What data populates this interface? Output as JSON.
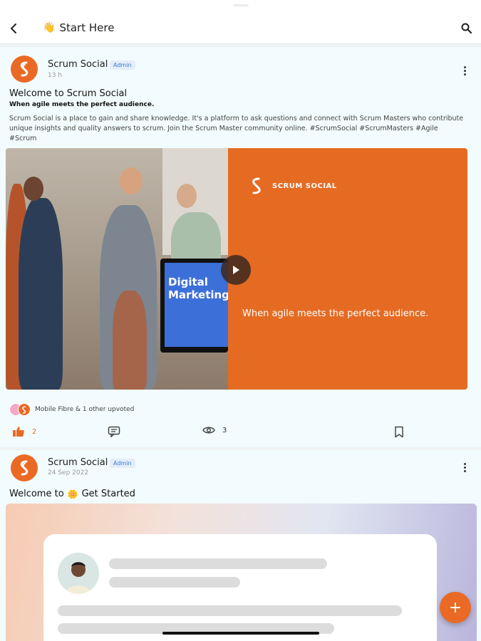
{
  "header": {
    "title": "Start Here",
    "title_emoji": "👋"
  },
  "posts": [
    {
      "author": "Scrum Social",
      "badge": "Admin",
      "time": "13 h",
      "title": "Welcome to Scrum Social",
      "subtitle": "When agile meets the perfect audience.",
      "body": "Scrum Social is a place to gain and share knowledge. It's a platform to ask questions and connect with Scrum Masters who contribute unique insights and quality answers to scrum. Join the Scrum Master community online. #ScrumSocial #ScrumMasters #Agile #Scrum",
      "media": {
        "monitor_text_line1": "Digital",
        "monitor_text_line2": "Marketing",
        "brand": "SCRUM SOCIAL",
        "tagline": "When agile meets the perfect audience."
      },
      "upvote_text": "Mobile Fibre & 1 other upvoted",
      "likes": "2",
      "views": "3"
    },
    {
      "author": "Scrum Social",
      "badge": "Admin",
      "time": "24 Sep 2022",
      "title_prefix": "Welcome to",
      "title_emoji": "🌼",
      "title_suffix": "Get Started"
    }
  ],
  "colors": {
    "brand_orange": "#EA6A25",
    "admin_badge": "#3A7BD5",
    "post_background": "#F2FBFD"
  },
  "icons": {
    "back": "chevron-left-icon",
    "search": "search-icon",
    "more": "more-vertical-icon",
    "like": "thumbs-up-icon",
    "comment": "comment-icon",
    "views": "eye-icon",
    "bookmark": "bookmark-icon",
    "play": "play-icon",
    "fab": "plus-icon"
  }
}
